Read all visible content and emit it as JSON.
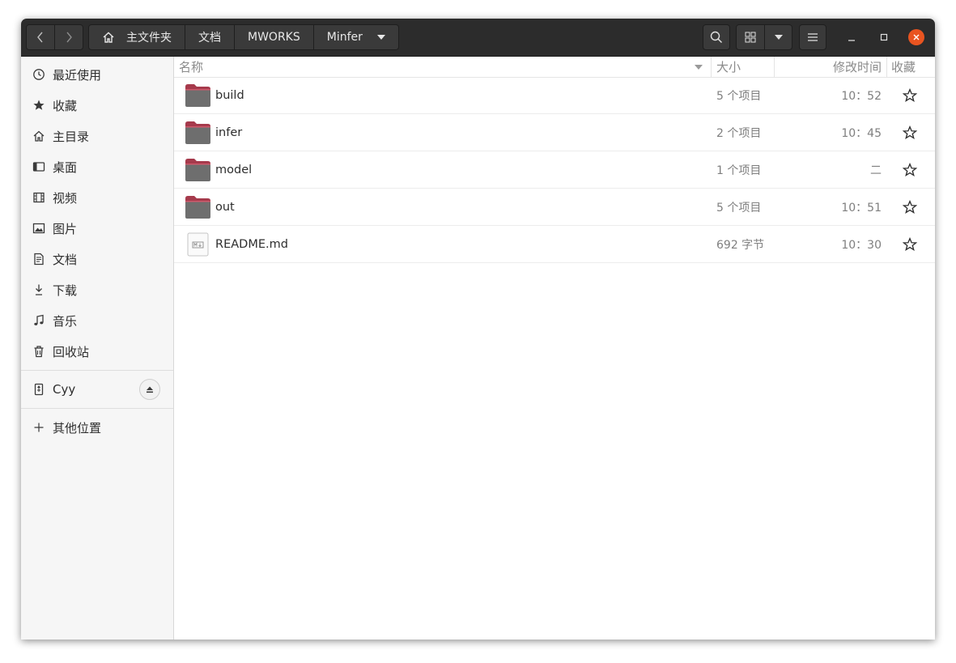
{
  "headerbar": {
    "breadcrumbs": [
      "主文件夹",
      "文档",
      "MWORKS",
      "Minfer"
    ]
  },
  "sidebar": {
    "places": [
      {
        "label": "最近使用",
        "icon": "clock-icon"
      },
      {
        "label": "收藏",
        "icon": "star-filled-icon"
      },
      {
        "label": "主目录",
        "icon": "home-icon"
      },
      {
        "label": "桌面",
        "icon": "desktop-icon"
      },
      {
        "label": "视频",
        "icon": "film-icon"
      },
      {
        "label": "图片",
        "icon": "image-icon"
      },
      {
        "label": "文档",
        "icon": "document-icon"
      },
      {
        "label": "下载",
        "icon": "download-icon"
      },
      {
        "label": "音乐",
        "icon": "music-icon"
      },
      {
        "label": "回收站",
        "icon": "trash-icon"
      }
    ],
    "device": {
      "label": "Cyy",
      "icon": "usb-drive-icon"
    },
    "other": {
      "label": "其他位置",
      "icon": "plus-icon"
    }
  },
  "columns": {
    "name": "名称",
    "size": "大小",
    "modified": "修改时间",
    "starred": "收藏"
  },
  "files": [
    {
      "name": "build",
      "type": "folder",
      "size": "5 个项目",
      "modified": "10：52"
    },
    {
      "name": "infer",
      "type": "folder",
      "size": "2 个项目",
      "modified": "10：45"
    },
    {
      "name": "model",
      "type": "folder",
      "size": "1 个项目",
      "modified": "二"
    },
    {
      "name": "out",
      "type": "folder",
      "size": "5 个项目",
      "modified": "10：51"
    },
    {
      "name": "README.md",
      "type": "markdown",
      "size": "692 字节",
      "modified": "10：30"
    }
  ],
  "colors": {
    "headerbar": "#2c2c2c",
    "close_button": "#e95420",
    "folder_body": "#6e6e6e",
    "folder_tab": "#a63a4c"
  }
}
